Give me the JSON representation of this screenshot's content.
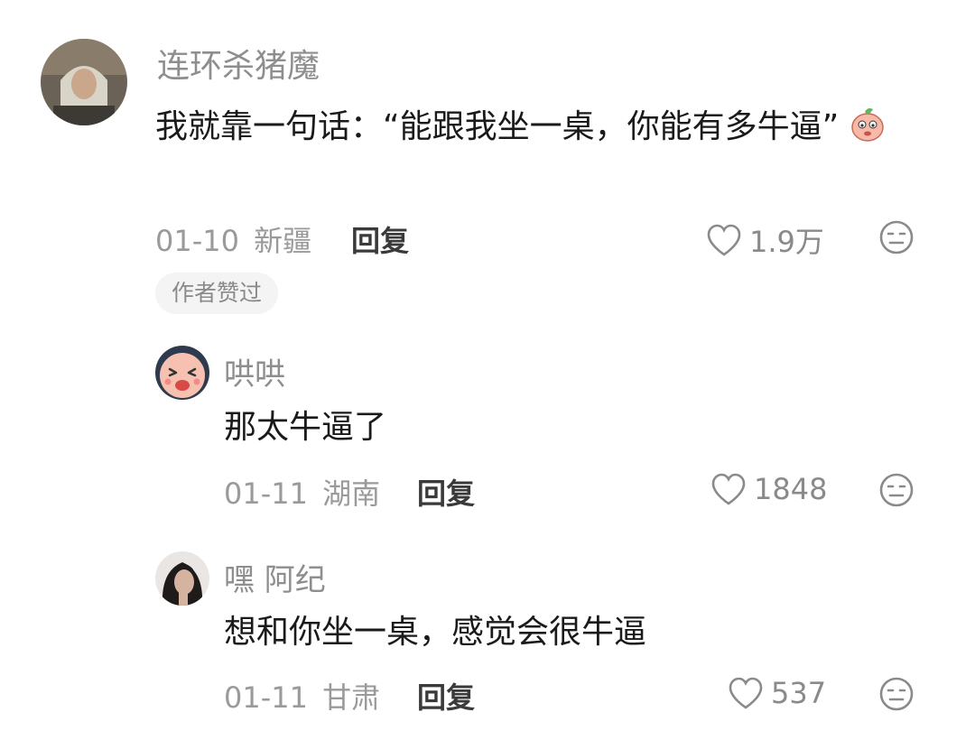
{
  "comments": [
    {
      "username": "连环杀猪魔",
      "text": "我就靠一句话：“能跟我坐一桌，你能有多牛逼”",
      "date": "01-10",
      "location": "新疆",
      "reply_label": "回复",
      "likes": "1.9万",
      "badge": "作者赞过"
    },
    {
      "username": "哄哄",
      "text": "那太牛逼了",
      "date": "01-11",
      "location": "湖南",
      "reply_label": "回复",
      "likes": "1848"
    },
    {
      "username": "嘿 阿纪",
      "text": "想和你坐一桌，感觉会很牛逼",
      "date": "01-11",
      "location": "甘肃",
      "reply_label": "回复",
      "likes": "537"
    }
  ],
  "icons": {
    "like": "heart-outline-icon",
    "dislike": "meh-face-icon",
    "emoji": "peach-emoji-icon"
  },
  "colors": {
    "username": "#8e8e8e",
    "text": "#1a1a1a",
    "meta": "#9a9a9a"
  }
}
